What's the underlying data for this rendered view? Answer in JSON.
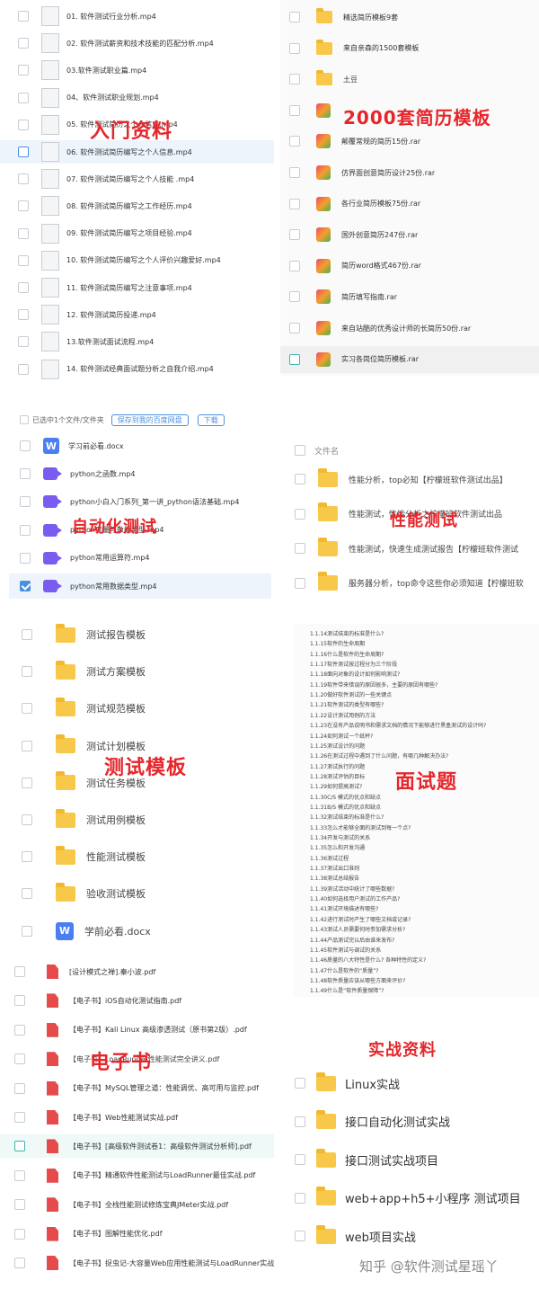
{
  "intro": {
    "label": "入门资料",
    "files": [
      "01. 软件测试行业分析.mp4",
      "02. 软件测试薪资和技术技能的匹配分析.mp4",
      "03.软件测试职业篇.mp4",
      "04、软件测试职业规划.mp4",
      "05. 软件测试简历之个人信息.mp4",
      "06. 软件测试简历编写之个人信息.mp4",
      "07. 软件测试简历编写之个人技能 .mp4",
      "08. 软件测试简历编写之工作经历.mp4",
      "09. 软件测试简历编写之项目经验.mp4",
      "10. 软件测试简历编写之个人评价兴趣爱好.mp4",
      "11. 软件测试简历编写之注意事项.mp4",
      "12. 软件测试简历投递.mp4",
      "13.软件测试面试流程.mp4",
      "14. 软件测试经典面试题分析之自我介绍.mp4"
    ]
  },
  "resume": {
    "label": "2000套简历模板",
    "files": [
      "精选简历模板9套",
      "来自亲森的1500套模板",
      "土豆",
      "2000套简历模板",
      "颠覆常规的简历15份.rar",
      "仿界面创意简历设计25份.rar",
      "各行业简历模板75份.rar",
      "国外创意简历247份.rar",
      "简历word格式467份.rar",
      "简历填写指南.rar",
      "来自站酷的优秀设计师的长简历50份.rar",
      "实习各岗位简历模板.rar"
    ]
  },
  "auto": {
    "label": "自动化测试",
    "toolbar": {
      "selected": "已选中1个文件/文件夹",
      "save": "保存到我的百度网盘",
      "download": "下载"
    },
    "files": [
      "学习前必看.docx",
      "python之函数.mp4",
      "python小白入门系列_第一讲_python语法基础.mp4",
      "python变量与数据类型.mp4",
      "python常用运算符.mp4",
      "python常用数据类型.mp4"
    ]
  },
  "perf": {
    "label": "性能测试",
    "header": "文件名",
    "files": [
      "性能分析，top必知【柠檬班软件测试出品】",
      "性能测试，性能分析之柠檬班软件测试出品",
      "性能测试，快速生成测试报告【柠檬班软件测试",
      "服务器分析，top命令这些你必须知道【柠檬班软"
    ]
  },
  "tmpl": {
    "label": "测试模板",
    "files": [
      "测试报告模板",
      "测试方案模板",
      "测试规范模板",
      "测试计划模板",
      "测试任务模板",
      "测试用例模板",
      "性能测试模板",
      "验收测试模板",
      "学前必看.docx"
    ]
  },
  "interview": {
    "label": "面试题",
    "items": [
      "1.1.14测试结束的标准是什么?",
      "1.1.15软件的生命周期",
      "1.1.16什么是软件的生命周期?",
      "1.1.17软件测试按过程分为三个阶段",
      "1.1.18面向对象的设计如何影响测试?",
      "1.1.19软件带来错误的原因很多，主要的原因有哪些?",
      "1.1.20做好软件测试的一些关键点",
      "1.1.21软件测试的类型有哪些?",
      "1.1.22设计测试用例的方法",
      "1.1.23在没有产品说明书和需求文档的情况下能够进行黑盒测试的设计吗?",
      "1.1.24如何测试一个纸杯?",
      "1.1.25测试设计的问题",
      "1.1.26在测试过程中遇到了什么问题，有哪几种解决办法?",
      "1.1.27测试执行的问题",
      "1.1.28测试评估的目标",
      "1.1.29如何提高测试?",
      "1.1.30C/S 模式的优点和缺点",
      "1.1.31B/S 模式的优点和缺点",
      "1.1.32测试结束的标准是什么?",
      "1.1.33怎么才能够全面的测试到每一个点?",
      "1.1.34开发与测试的关系",
      "1.1.35怎么和开发沟通",
      "1.1.36测试过程",
      "1.1.37测试出口准则",
      "1.1.38测试总结报告",
      "1.1.39测试活动中统计了哪些数据?",
      "1.1.40如何选择用户测试的工作产品?",
      "1.1.41测试环境描述有哪些?",
      "1.1.42进行测试时产生了哪些文档或记录?",
      "1.1.43测试人员需要何时参加需求分析?",
      "1.1.44产品测试完以后由谁来发布?",
      "1.1.45软件测试与调试的关系",
      "1.1.46质量的八大特性是什么? 各种特性的定义?",
      "1.1.47什么是软件的“质量”?",
      "1.1.48软件质量应该从哪些方面来评价?",
      "1.1.49什么是“软件质量保障”?"
    ]
  },
  "ebook": {
    "label": "电子书",
    "files": [
      "[设计模式之禅].秦小波.pdf",
      "【电子书】iOS自动化测试指南.pdf",
      "【电子书】Kali Linux 高级渗透测试（原书第2版）.pdf",
      "【电子书】LoadRunner性能测试完全讲义.pdf",
      "【电子书】MySQL管理之道：性能调优、高可用与监控.pdf",
      "【电子书】Web性能测试实战.pdf",
      "【电子书】[高级软件测试卷1：高级软件测试分析师].pdf",
      "【电子书】精通软件性能测试与LoadRunner最佳实战.pdf",
      "【电子书】全栈性能测试修炼宝典JMeter实战.pdf",
      "【电子书】图解性能优化.pdf",
      "【电子书】捉虫记-大容量Web应用性能测试与LoadRunner实战_.pdf"
    ]
  },
  "practice": {
    "label": "实战资料",
    "files": [
      "Linux实战",
      "接口自动化测试实战",
      "接口测试实战项目",
      "web+app+h5+小程序 测试项目",
      "web项目实战"
    ]
  },
  "watermark": "知乎 @软件测试星瑶丫"
}
